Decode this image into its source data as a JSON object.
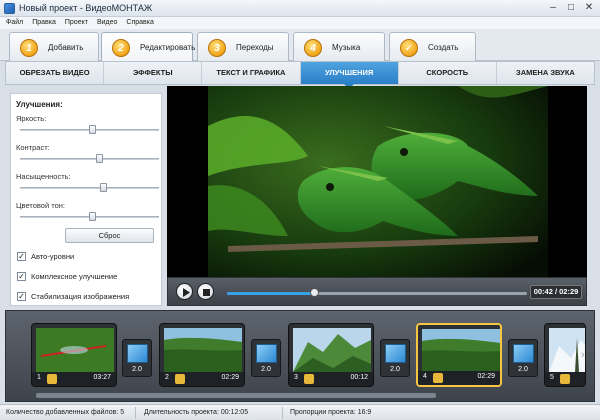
{
  "window": {
    "title": "Новый проект - ВидеоМОНТАЖ"
  },
  "menu": [
    "Файл",
    "Правка",
    "Проект",
    "Видео",
    "Справка"
  ],
  "steps": [
    {
      "num": "1",
      "label": "Добавить"
    },
    {
      "num": "2",
      "label": "Редактировать",
      "active": true
    },
    {
      "num": "3",
      "label": "Переходы"
    },
    {
      "num": "4",
      "label": "Музыка"
    },
    {
      "num": "",
      "label": "Создать"
    }
  ],
  "subtabs": [
    "ОБРЕЗАТЬ ВИДЕО",
    "ЭФФЕКТЫ",
    "ТЕКСТ И ГРАФИКА",
    "УЛУЧШЕНИЯ",
    "СКОРОСТЬ",
    "ЗАМЕНА ЗВУКА"
  ],
  "enhancements": {
    "title": "Улучшения:",
    "sliders": [
      {
        "label": "Яркость:",
        "value": 0.52
      },
      {
        "label": "Контраст:",
        "value": 0.57
      },
      {
        "label": "Насыщенность:",
        "value": 0.6
      },
      {
        "label": "Цветовой тон:",
        "value": 0.52
      }
    ],
    "reset_label": "Сброс",
    "checks": [
      {
        "label": "Авто-уровни",
        "checked": true
      },
      {
        "label": "Комплексное улучшение",
        "checked": true
      },
      {
        "label": "Стабилизация изображения",
        "checked": true
      }
    ]
  },
  "player": {
    "timecode": "00:42 / 02:29",
    "progress": 0.29
  },
  "timeline": {
    "clips": [
      {
        "num": "1",
        "duration": "03:27",
        "thumb": "dragonfly"
      },
      {
        "num": "2",
        "duration": "02:29",
        "thumb": "forest"
      },
      {
        "num": "3",
        "duration": "00:12",
        "thumb": "mountain"
      },
      {
        "num": "4",
        "duration": "02:29",
        "thumb": "forest",
        "selected": true
      },
      {
        "num": "5",
        "duration": "",
        "thumb": "snow"
      }
    ],
    "transitions": [
      "2.0",
      "2.0",
      "2.0",
      "2.0"
    ]
  },
  "status": {
    "files": "Количество добавленных файлов: 5",
    "duration": "Длительность проекта:  00:12:05",
    "ratio": "Пропорции проекта:  16:9"
  },
  "colors": {
    "accent": "#2b7fc7",
    "step_icon": "#f2a51a",
    "selected_clip": "#f5c542"
  }
}
